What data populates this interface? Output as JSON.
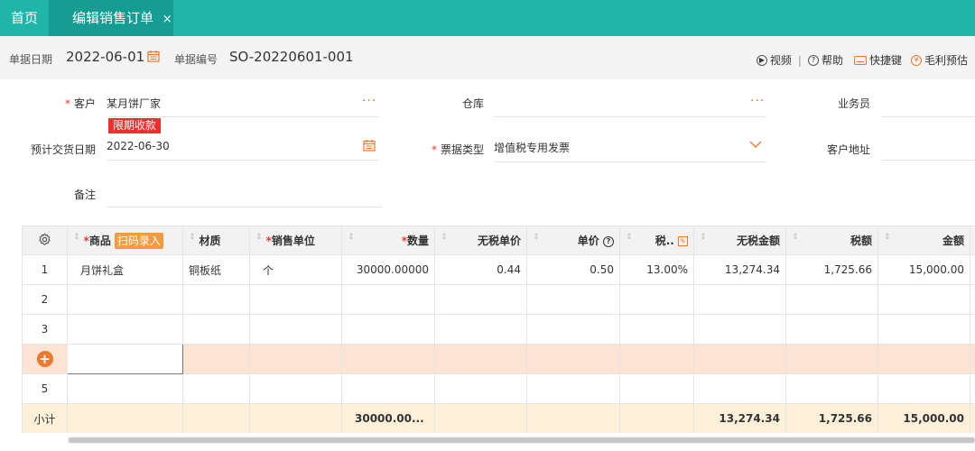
{
  "tabs": {
    "home": "首页",
    "active": "编辑销售订单",
    "close": "×"
  },
  "header": {
    "date_label": "单据日期",
    "date_value": "2022-06-01",
    "no_label": "单据编号",
    "no_value": "SO-20220601-001",
    "links": {
      "video": "视频",
      "help": "帮助",
      "shortcut": "快捷键",
      "profit": "毛利预估"
    }
  },
  "form": {
    "customer": {
      "label": "客户",
      "value": "某月饼厂家",
      "tag": "限期收款"
    },
    "warehouse": {
      "label": "仓库",
      "value": ""
    },
    "salesman": {
      "label": "业务员",
      "value": ""
    },
    "delivery": {
      "label": "预计交货日期",
      "value": "2022-06-30"
    },
    "invoice_type": {
      "label": "票据类型",
      "value": "增值税专用发票"
    },
    "address": {
      "label": "客户地址",
      "value": ""
    },
    "remark": {
      "label": "备注",
      "value": ""
    },
    "more_glyph": "···"
  },
  "table": {
    "columns": {
      "product": "商品",
      "scan": "扫码录入",
      "material": "材质",
      "unit": "销售单位",
      "qty": "数量",
      "price_ex": "无税单价",
      "price": "单价",
      "tax_rate": "税..",
      "amount_ex": "无税金额",
      "tax": "税额",
      "amount": "金额"
    },
    "rows": [
      {
        "idx": "1",
        "product": "月饼礼盒",
        "material": "铜板纸",
        "unit": "个",
        "qty": "30000.00000",
        "price_ex": "0.44",
        "price": "0.50",
        "tax_rate": "13.00%",
        "amount_ex": "13,274.34",
        "tax": "1,725.66",
        "amount": "15,000.00"
      },
      {
        "idx": "2"
      },
      {
        "idx": "3"
      },
      {
        "idx": "+"
      },
      {
        "idx": "5"
      }
    ],
    "subtotal": {
      "label": "小计",
      "qty": "30000.00...",
      "amount_ex": "13,274.34",
      "tax": "1,725.66",
      "amount": "15,000.00"
    }
  },
  "colors": {
    "accent": "#1fb5a9",
    "accent_dark": "#169c91",
    "orange": "#f0782d",
    "red": "#ef2e2e"
  }
}
